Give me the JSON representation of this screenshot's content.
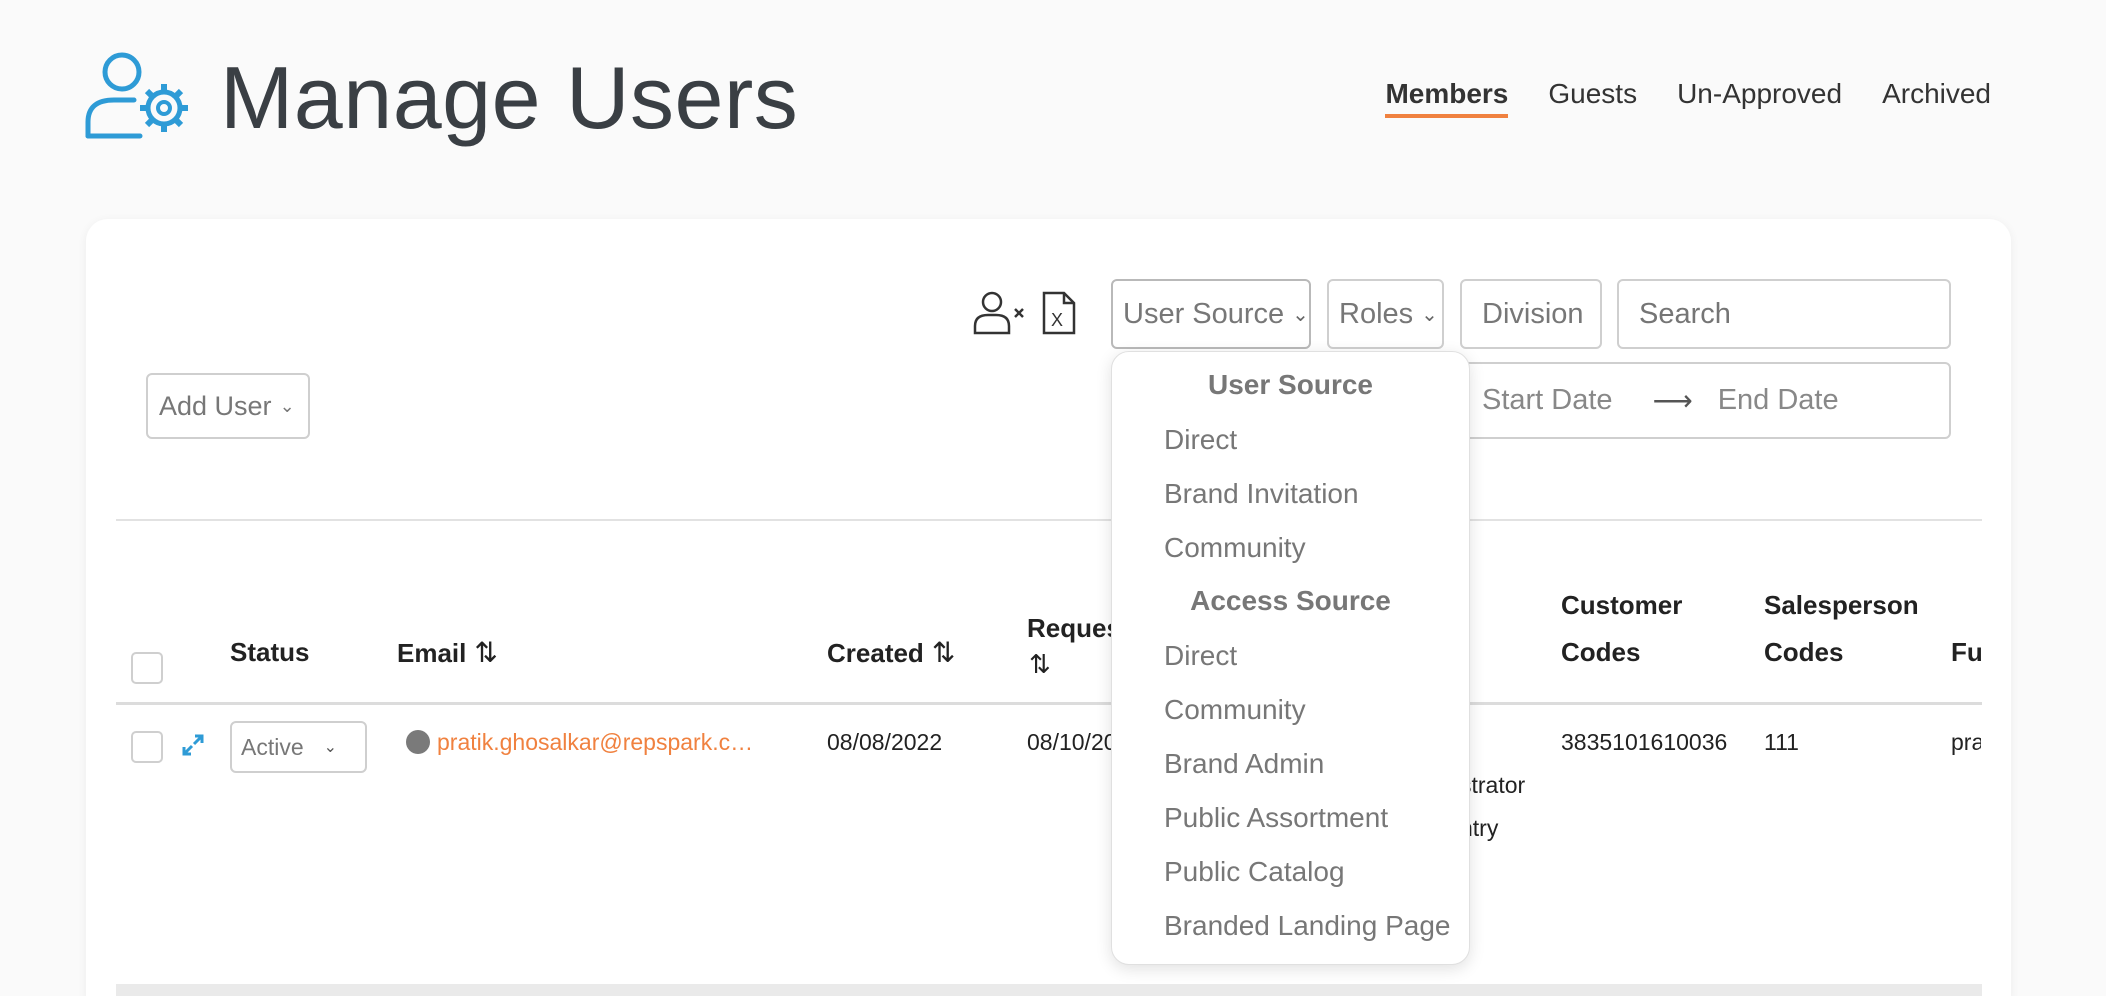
{
  "header": {
    "title": "Manage Users",
    "tabs": [
      {
        "label": "Members",
        "active": true
      },
      {
        "label": "Guests",
        "active": false
      },
      {
        "label": "Un-Approved",
        "active": false
      },
      {
        "label": "Archived",
        "active": false
      }
    ]
  },
  "toolbar": {
    "add_user_label": "Add User",
    "user_source_label": "User Source",
    "roles_label": "Roles",
    "division_label": "Division",
    "search_placeholder": "Search",
    "start_date_placeholder": "Start Date",
    "end_date_placeholder": "End Date"
  },
  "table": {
    "headers": {
      "status": "Status",
      "email": "Email",
      "created": "Created",
      "requested": "Reques",
      "customer_codes_1": "Customer",
      "customer_codes_2": "Codes",
      "salesperson_codes_1": "Salesperson",
      "salesperson_codes_2": "Codes",
      "fu": "Fu"
    },
    "rows": [
      {
        "status": "Active",
        "email": "pratik.ghosalkar@repspark.c…",
        "created": "08/08/2022",
        "requested": "08/10/20",
        "role_line_1": "strator",
        "role_line_2": "ntry",
        "customer_codes": "3835101610036",
        "salesperson_codes": "111",
        "fu": "pra"
      }
    ]
  },
  "dropdown": {
    "group_user_source": "User Source",
    "user_source_options": [
      "Direct",
      "Brand Invitation",
      "Community"
    ],
    "group_access_source": "Access Source",
    "access_source_options": [
      "Direct",
      "Community",
      "Brand Admin",
      "Public Assortment",
      "Public Catalog",
      "Branded Landing Page"
    ]
  },
  "colors": {
    "accent": "#f0813f",
    "icon_blue": "#2e9bd6"
  }
}
